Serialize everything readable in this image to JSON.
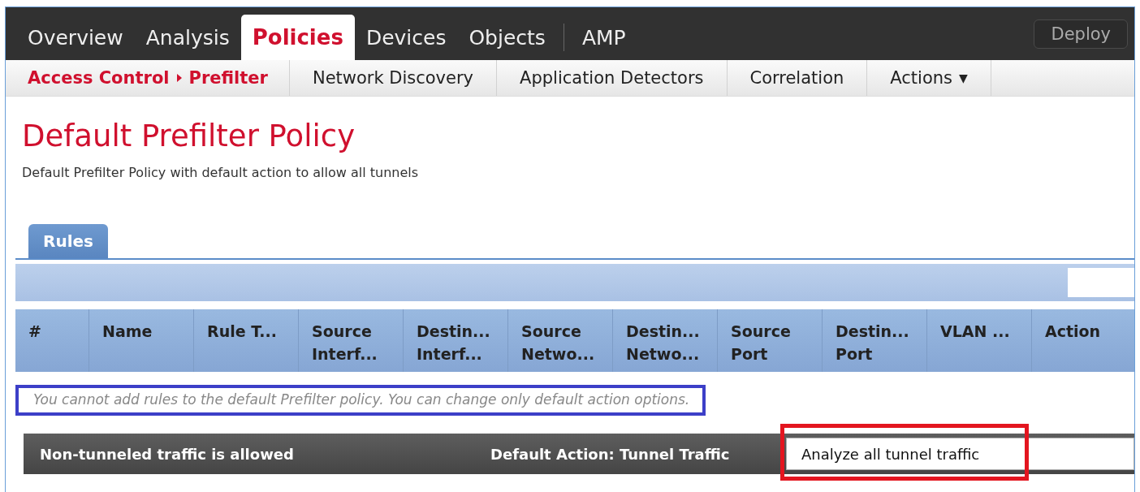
{
  "nav": {
    "tabs": [
      {
        "label": "Overview",
        "selected": false
      },
      {
        "label": "Analysis",
        "selected": false
      },
      {
        "label": "Policies",
        "selected": true
      },
      {
        "label": "Devices",
        "selected": false
      },
      {
        "label": "Objects",
        "selected": false
      },
      {
        "label": "AMP",
        "selected": false
      }
    ],
    "deploy_button": "Deploy"
  },
  "subnav": {
    "items": [
      {
        "kind": "breadcrumb",
        "parent": "Access Control",
        "label": "Prefilter",
        "selected": true
      },
      {
        "kind": "link",
        "label": "Network Discovery",
        "selected": false
      },
      {
        "kind": "link",
        "label": "Application Detectors",
        "selected": false
      },
      {
        "kind": "link",
        "label": "Correlation",
        "selected": false
      },
      {
        "kind": "menu",
        "label": "Actions",
        "caret": "▼",
        "selected": false
      }
    ]
  },
  "page": {
    "title": "Default Prefilter Policy",
    "description": "Default Prefilter Policy with default action to allow all tunnels"
  },
  "tabs": [
    {
      "label": "Rules",
      "selected": true
    }
  ],
  "table": {
    "columns": [
      {
        "lines": [
          "#"
        ]
      },
      {
        "lines": [
          "Name"
        ]
      },
      {
        "lines": [
          "Rule T..."
        ]
      },
      {
        "lines": [
          "Source",
          "Interf..."
        ]
      },
      {
        "lines": [
          "Destin...",
          "Interf..."
        ]
      },
      {
        "lines": [
          "Source",
          "Netwo..."
        ]
      },
      {
        "lines": [
          "Destin...",
          "Netwo..."
        ]
      },
      {
        "lines": [
          "Source",
          "Port"
        ]
      },
      {
        "lines": [
          "Destin...",
          "Port"
        ]
      },
      {
        "lines": [
          "VLAN ..."
        ]
      },
      {
        "lines": [
          "Action"
        ]
      }
    ],
    "notice": "You cannot add rules to the default Prefilter policy. You can change only default action options."
  },
  "footer": {
    "traffic_note": "Non-tunneled traffic is allowed",
    "default_action_label": "Default Action: Tunnel Traffic",
    "default_action_value": "Analyze all tunnel traffic"
  },
  "highlights": [
    {
      "kind": "notice",
      "color": "#3c3fc8"
    },
    {
      "kind": "select",
      "color": "#e3151f"
    }
  ]
}
